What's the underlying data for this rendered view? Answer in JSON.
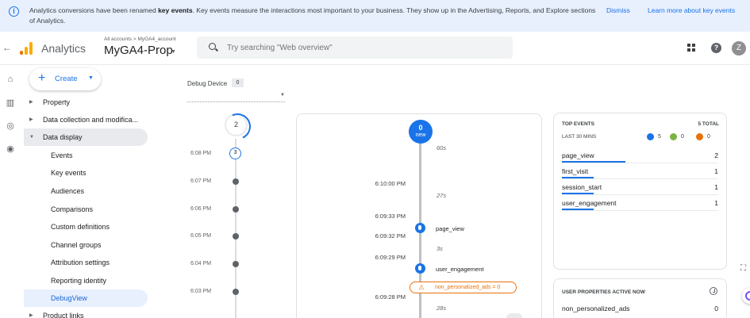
{
  "banner": {
    "message_pre": "Analytics conversions have been renamed ",
    "message_bold": "key events",
    "message_post": ". Key events measure the interactions most important to your business. They show up in the Advertising, Reports, and Explore sections of Analytics.",
    "dismiss_label": "Dismiss",
    "learn_more_label": "Learn more about key events"
  },
  "header": {
    "product_name": "Analytics",
    "breadcrumb": "All accounts > MyGA4_account",
    "property_name": "MyGA4-Prop",
    "search_placeholder": "Try searching \"Web overview\"",
    "avatar_letter": "Z",
    "brand_colors": [
      "#f9ab00",
      "#e37400"
    ]
  },
  "rail": {
    "icons": [
      "home-icon",
      "reports-icon",
      "explore-icon",
      "advertising-icon"
    ]
  },
  "sidebar": {
    "create_label": "Create",
    "items": [
      {
        "label": "Property",
        "level": 0,
        "state": "collapsed"
      },
      {
        "label": "Data collection and modifica...",
        "level": 0,
        "state": "collapsed"
      },
      {
        "label": "Data display",
        "level": 0,
        "state": "expanded"
      },
      {
        "label": "Events",
        "level": 1
      },
      {
        "label": "Key events",
        "level": 1
      },
      {
        "label": "Audiences",
        "level": 1
      },
      {
        "label": "Comparisons",
        "level": 1
      },
      {
        "label": "Custom definitions",
        "level": 1
      },
      {
        "label": "Channel groups",
        "level": 1
      },
      {
        "label": "Attribution settings",
        "level": 1
      },
      {
        "label": "Reporting identity",
        "level": 1
      },
      {
        "label": "DebugView",
        "level": 1,
        "state": "active"
      },
      {
        "label": "Product links",
        "level": 0,
        "state": "collapsed"
      }
    ]
  },
  "debug_device": {
    "label": "Debug Device",
    "count": "0"
  },
  "minutes_stream": {
    "top_count": "2",
    "bubble_count": "3",
    "times": [
      "6:08 PM",
      "6:07 PM",
      "6:06 PM",
      "6:05 PM",
      "6:04 PM",
      "6:03 PM"
    ]
  },
  "seconds_stream": {
    "top_count": "0",
    "top_label": "new",
    "timestamps": [
      "6:10:00 PM",
      "6:09:33 PM",
      "6:09:32 PM",
      "6:09:29 PM",
      "6:09:28 PM"
    ],
    "gaps": [
      "60s",
      "27s",
      "3s",
      "28s"
    ],
    "events": [
      {
        "label": "page_view"
      },
      {
        "label": "user_engagement"
      }
    ],
    "warning_event": "non_personalized_ads = 0"
  },
  "top_events": {
    "title": "TOP EVENTS",
    "total": "5 TOTAL",
    "subtitle": "LAST 30 MINS",
    "counts": [
      {
        "icon": "event-count-icon",
        "value": "5",
        "color": "#1a73e8"
      },
      {
        "icon": "key-event-count-icon",
        "value": "0",
        "color": "#7cb342"
      },
      {
        "icon": "error-count-icon",
        "value": "0",
        "color": "#e8710a"
      }
    ],
    "rows": [
      {
        "name": "page_view",
        "count": "2",
        "share": 0.4
      },
      {
        "name": "first_visit",
        "count": "1",
        "share": 0.2
      },
      {
        "name": "session_start",
        "count": "1",
        "share": 0.2
      },
      {
        "name": "user_engagement",
        "count": "1",
        "share": 0.2
      }
    ]
  },
  "user_properties": {
    "title": "USER PROPERTIES ACTIVE NOW",
    "rows": [
      {
        "name": "non_personalized_ads",
        "value": "0"
      }
    ]
  }
}
